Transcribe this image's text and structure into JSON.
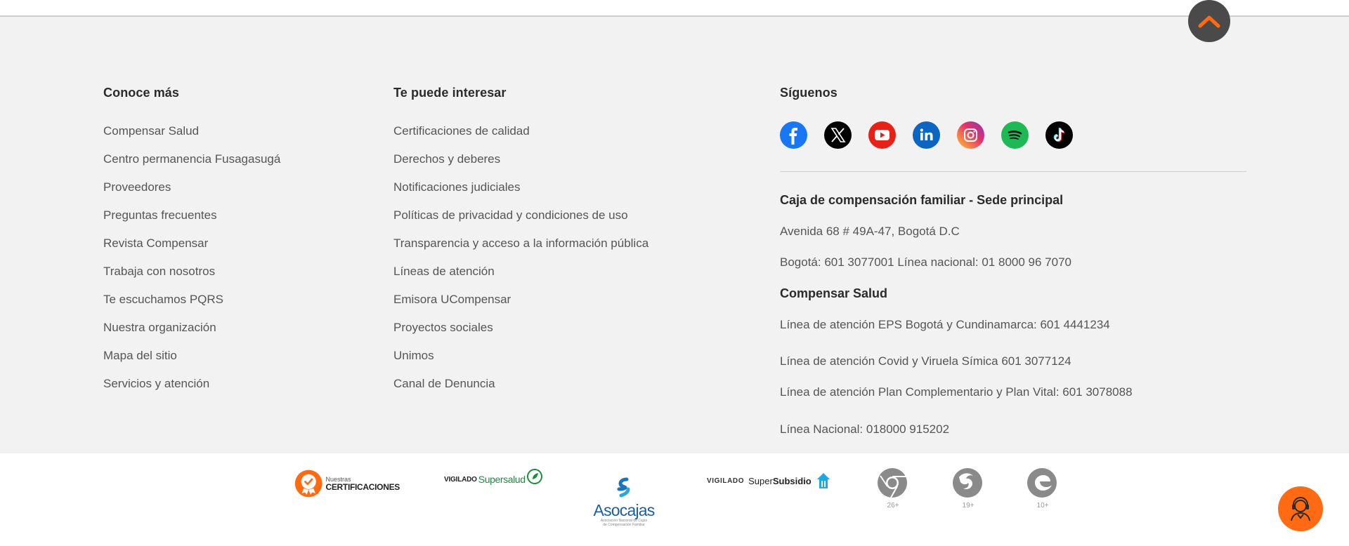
{
  "columns": {
    "conoce": {
      "title": "Conoce más",
      "links": [
        "Compensar Salud",
        "Centro permanencia Fusagasugá",
        "Proveedores",
        "Preguntas frecuentes",
        "Revista Compensar",
        "Trabaja con nosotros",
        "Te escuchamos PQRS",
        "Nuestra organización",
        "Mapa del sitio",
        "Servicios y atención"
      ]
    },
    "interesar": {
      "title": "Te puede interesar",
      "links": [
        "Certificaciones de calidad",
        "Derechos y deberes",
        "Notificaciones judiciales",
        "Políticas de privacidad y condiciones de uso",
        "Transparencia y acceso a la información pública",
        "Líneas de atención",
        "Emisora UCompensar",
        "Proyectos sociales",
        "Unimos",
        "Canal de Denuncia"
      ]
    }
  },
  "siguenos": {
    "title": "Síguenos",
    "icons": [
      "facebook-icon",
      "x-twitter-icon",
      "youtube-icon",
      "linkedin-icon",
      "instagram-icon",
      "spotify-icon",
      "tiktok-icon"
    ]
  },
  "contact": {
    "sede_title": "Caja de compensación familiar - Sede principal",
    "address": "Avenida 68 # 49A-47, Bogotá D.C",
    "phones": "Bogotá: 601 3077001 Línea nacional: 01 8000 96 7070",
    "salud_title": "Compensar Salud",
    "lines": [
      "Línea de atención EPS Bogotá y Cundinamarca: 601 4441234",
      "Línea de atención Covid y Viruela Símica 601 3077124",
      "Línea de atención Plan Complementario y Plan Vital: 601 3078088",
      "Línea Nacional: 018000 915202"
    ]
  },
  "logos": {
    "cert_small": "Nuestras",
    "cert_big": "CERTIFICACIONES",
    "supersalud_a": "VIGILADO",
    "supersalud_b": "Supersalud",
    "asocajas": "Asocajas",
    "asocajas_sub1": "Asociación Nacional de Cajas",
    "asocajas_sub2": "de Compensación Familiar",
    "supersubsidio_a": "VIGILADO",
    "supersubsidio_b": "Super",
    "supersubsidio_c": "Subsidio",
    "browsers": [
      {
        "icon": "chrome-icon",
        "version": "26+"
      },
      {
        "icon": "firefox-icon",
        "version": "19+"
      },
      {
        "icon": "edge-icon",
        "version": "10+"
      }
    ]
  },
  "colors": {
    "accent": "#ff6a13",
    "footer_bg": "#f2f2f2",
    "scroll_btn": "#4a4a4a"
  }
}
